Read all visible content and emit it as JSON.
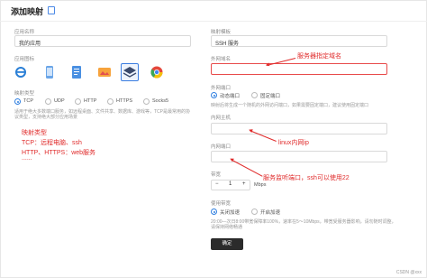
{
  "header": {
    "title": "添加映射"
  },
  "left": {
    "app_name_label": "应用名称",
    "app_name_value": "我的应用",
    "app_icon_label": "应用图标",
    "icons": [
      "ie-icon",
      "phone-icon",
      "doc-icon",
      "gallery-icon",
      "layers-icon",
      "chrome-icon"
    ],
    "mapping_type_label": "映射类型",
    "types": [
      "TCP",
      "UDP",
      "HTTP",
      "HTTPS",
      "Socks5"
    ],
    "type_hint": "适用于绝大多数端口服务，如远程桌面、文件共享、数据库、游戏等，TCP是最常用的协议类型，支持绝大部分应用场景",
    "note_title": "映射类型",
    "note_tcp": "TCP：远程电脑、ssh",
    "note_http": "HTTP、HTTPS：web服务",
    "note_dots": "......"
  },
  "right": {
    "template_label": "映射模板",
    "template_value": "SSH 服务",
    "domain_label": "外网域名",
    "domain_value": "",
    "outer_port_label": "外网端口",
    "port_options": [
      "动态端口",
      "固定端口"
    ],
    "port_hint": "映射后将生成一个随机的外网访问端口，如果需要固定端口，建议使用固定端口",
    "ip_label": "内网主机",
    "ip_value": "",
    "inner_port_label": "内网端口",
    "inner_port_value": "",
    "bandwidth_label": "带宽",
    "bandwidth_value": "1",
    "bandwidth_unit": "Mbps",
    "accel_label": "使用带宽",
    "accel_options": [
      "关闭加速",
      "开启加速"
    ],
    "accel_hint": "20:00—次日8:00带宽保障率100%，速率在5～10Mbps，带宽受服务器影响，请勿随时调整，请保持网络畅通",
    "confirm": "确定"
  },
  "annotations": {
    "domain": "服务器指定域名",
    "ip": "linux内网ip",
    "port": "服务监听端口，ssh可以使用22"
  },
  "watermark": "CSDN @xxx"
}
